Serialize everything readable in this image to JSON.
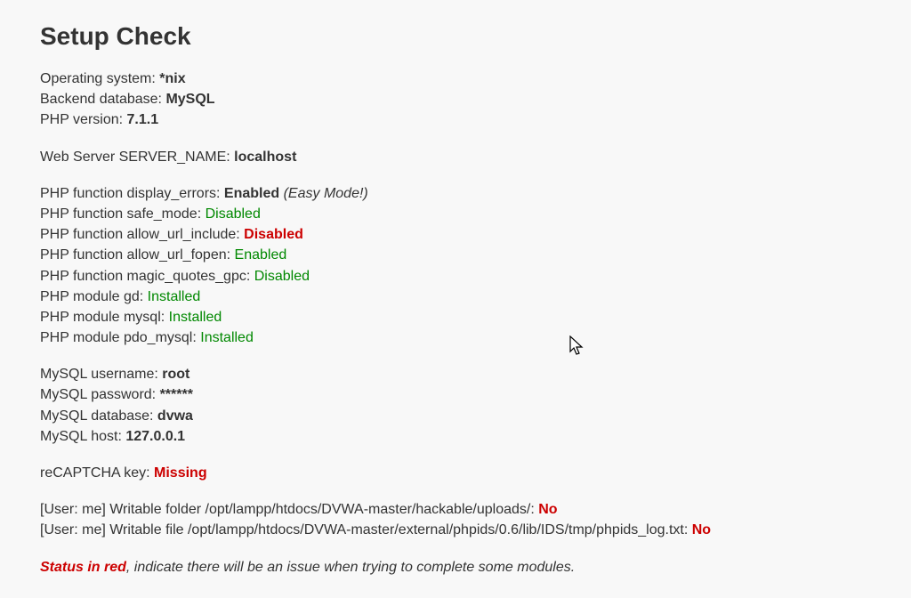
{
  "title": "Setup Check",
  "info": {
    "os_label": "Operating system: ",
    "os_value": "*nix",
    "db_label": "Backend database: ",
    "db_value": "MySQL",
    "php_label": "PHP version: ",
    "php_value": "7.1.1"
  },
  "server": {
    "name_label": "Web Server SERVER_NAME: ",
    "name_value": "localhost"
  },
  "php": {
    "display_errors_label": "PHP function display_errors: ",
    "display_errors_value": "Enabled",
    "display_errors_note": " (Easy Mode!)",
    "safe_mode_label": "PHP function safe_mode: ",
    "safe_mode_value": "Disabled",
    "allow_url_include_label": "PHP function allow_url_include: ",
    "allow_url_include_value": "Disabled",
    "allow_url_fopen_label": "PHP function allow_url_fopen: ",
    "allow_url_fopen_value": "Enabled",
    "magic_quotes_label": "PHP function magic_quotes_gpc: ",
    "magic_quotes_value": "Disabled",
    "gd_label": "PHP module gd: ",
    "gd_value": "Installed",
    "mysql_label": "PHP module mysql: ",
    "mysql_value": "Installed",
    "pdo_label": "PHP module pdo_mysql: ",
    "pdo_value": "Installed"
  },
  "mysql": {
    "user_label": "MySQL username: ",
    "user_value": "root",
    "pass_label": "MySQL password: ",
    "pass_value": "******",
    "db_label": "MySQL database: ",
    "db_value": "dvwa",
    "host_label": "MySQL host: ",
    "host_value": "127.0.0.1"
  },
  "recaptcha": {
    "label": "reCAPTCHA key: ",
    "value": "Missing"
  },
  "writable": {
    "folder_label": "[User: me] Writable folder /opt/lampp/htdocs/DVWA-master/hackable/uploads/: ",
    "folder_value": "No",
    "file_label": "[User: me] Writable file /opt/lampp/htdocs/DVWA-master/external/phpids/0.6/lib/IDS/tmp/phpids_log.txt: ",
    "file_value": "No"
  },
  "status": {
    "prefix": "Status in red",
    "rest": ", indicate there will be an issue when trying to complete some modules."
  }
}
